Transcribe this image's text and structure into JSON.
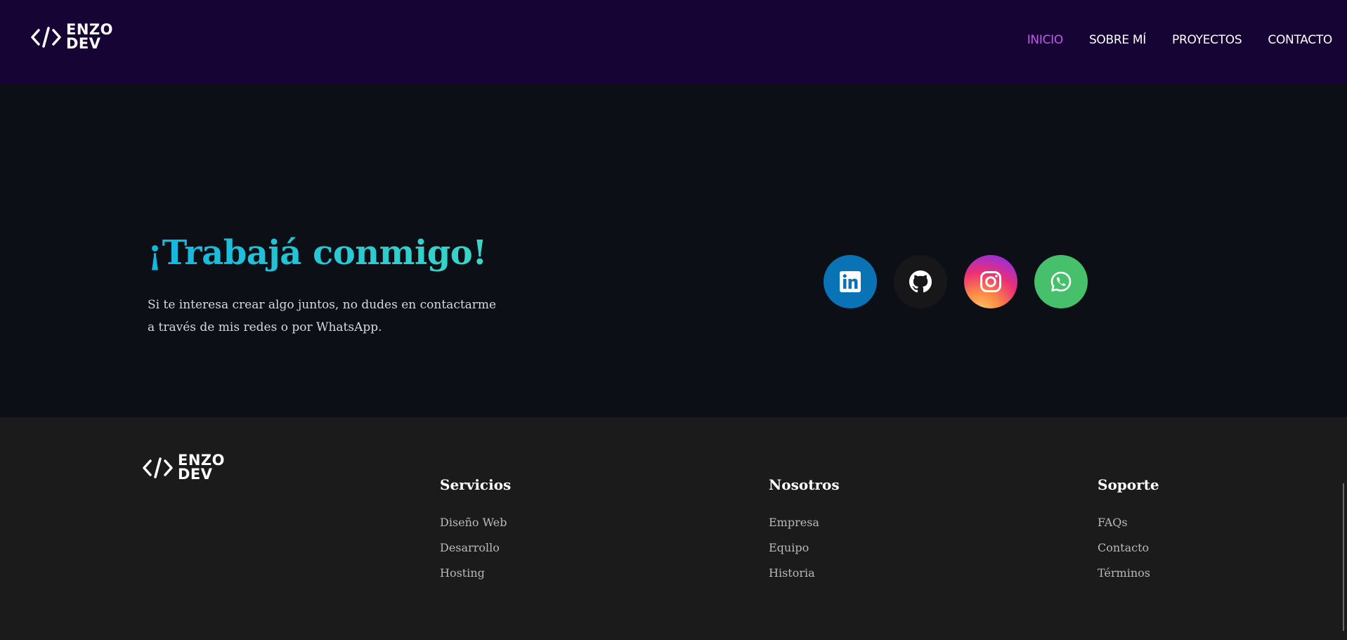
{
  "header": {
    "logo": {
      "line1": "ENZO",
      "line2": "DEV"
    },
    "nav": [
      {
        "label": "INICIO",
        "active": true
      },
      {
        "label": "SOBRE MÍ",
        "active": false
      },
      {
        "label": "PROYECTOS",
        "active": false
      },
      {
        "label": "CONTACTO",
        "active": false
      }
    ]
  },
  "main": {
    "headline": "¡Trabajá conmigo!",
    "subtext": "Si te interesa crear algo juntos, no dudes en contactarme a través de mis redes o por WhatsApp.",
    "socials": [
      {
        "name": "LinkedIn",
        "icon": "linkedin-icon",
        "color": "#0a73b5"
      },
      {
        "name": "GitHub",
        "icon": "github-icon",
        "color": "#17171a"
      },
      {
        "name": "Instagram",
        "icon": "instagram-icon",
        "color": "#ec2f75"
      },
      {
        "name": "WhatsApp",
        "icon": "whatsapp-icon",
        "color": "#46c06a"
      }
    ]
  },
  "footer": {
    "logo": {
      "line1": "ENZO",
      "line2": "DEV"
    },
    "columns": [
      {
        "title": "Servicios",
        "links": [
          "Diseño Web",
          "Desarrollo",
          "Hosting"
        ]
      },
      {
        "title": "Nosotros",
        "links": [
          "Empresa",
          "Equipo",
          "Historia"
        ]
      },
      {
        "title": "Soporte",
        "links": [
          "FAQs",
          "Contacto",
          "Términos"
        ]
      }
    ]
  },
  "colors": {
    "header_bg": "#160434",
    "main_bg": "#0c1016",
    "footer_bg": "#1b1b1b",
    "nav_active": "#c45ae8",
    "headline_gradient_start": "#13b6df",
    "headline_gradient_end": "#3ad6c8"
  }
}
